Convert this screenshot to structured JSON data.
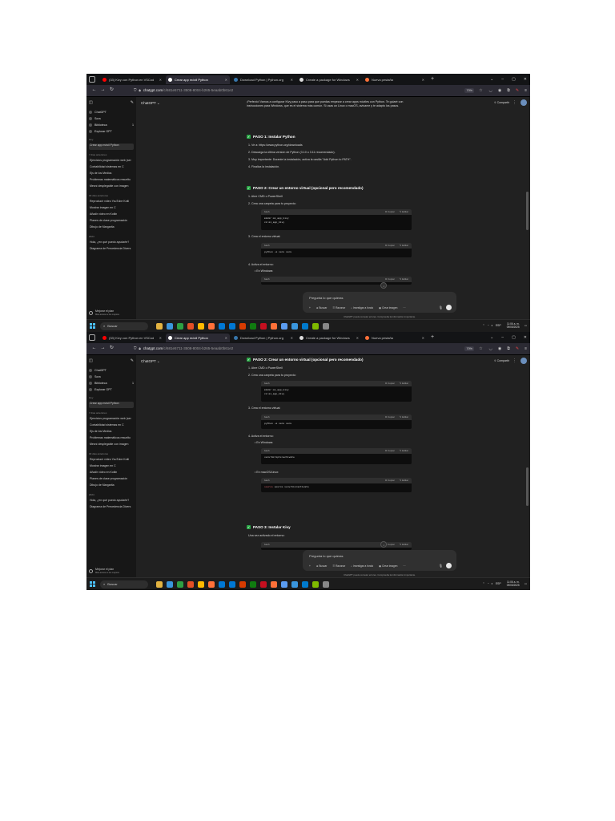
{
  "browser": {
    "tabs": [
      {
        "label": "(33) Kivy con Python en VSCod",
        "color": "#ff0000"
      },
      {
        "label": "Crear app móvil Python",
        "color": "#ffffff",
        "active": true
      },
      {
        "label": "Download Python | Python.org",
        "color": "#3776ab"
      },
      {
        "label": "Create a package for Windows",
        "color": "#dddddd"
      },
      {
        "label": "Nueva pestaña",
        "color": "#ff7139"
      }
    ],
    "new_tab": "+",
    "url_domain": "chatgpt.com",
    "url_path": "/c/681e5711-3508-8004-b265-5eaab0b61e2",
    "zoom": "70%",
    "controls": [
      "⌄",
      "–",
      "▢",
      "✕"
    ]
  },
  "sidebar": {
    "top_items": [
      {
        "label": "ChatGPT"
      },
      {
        "label": "Sora"
      },
      {
        "label": "Biblioteca",
        "count": "1"
      },
      {
        "label": "Explorar GPT"
      }
    ],
    "sections": [
      {
        "title": "Hoy",
        "items": [
          "Crear app móvil Python"
        ]
      },
      {
        "title": "7 días anteriores",
        "items": [
          "Ejercicios programación web (ser",
          "Contabilidad sistemas en C",
          "Ejs de los Medios",
          "Problemas matemáticos resuelto",
          "Mesní desplegable con imagen"
        ]
      },
      {
        "title": "30 días anteriores",
        "items": [
          "Reproducir vídeo YouTube Kotli",
          "Mostrar imagen en C",
          "Añadir vídeo en Kotlin",
          "Planes de clase programación",
          "Dibujo de Margarita"
        ]
      },
      {
        "title": "2024",
        "items": [
          "Hola, ¿en qué puedo ayudarte?",
          "Diagrama de Precedencia Divers"
        ]
      }
    ],
    "plan": "Mejorar el plan",
    "plan_sub": "Más acceso a los mejores"
  },
  "header": {
    "model": "ChatGPT ⌄",
    "share": "⇪ Compartir",
    "more": "⋮"
  },
  "chatA": {
    "intro": "¡Perfecto! Vamos a configurar Kivy paso a paso para que puedas empezar a crear apps móviles con Python. Te guiaré con instrucciones para Windows, que es el sistema más común. Si usas un Linux o macOS, avísame y te adapto los pasos.",
    "step1_title": "PASO 1: Instalar Python",
    "step1_items": [
      "1. Ve a: https://www.python.org/downloads",
      "2. Descarga la última versión de Python (3.10 o 3.11 recomendado).",
      "3. Muy importante: Durante la instalación, activa la casilla \"Add Python to PATH\".",
      "4. Finaliza la instalación."
    ],
    "step2_title": "PASO 2: Crear un entorno virtual (opcional pero recomendado)",
    "step2_i1": "1. Abre CMD o PowerShell",
    "step2_i2": "2. Crea una carpeta para tu proyecto:",
    "code1": "mkdir mi_app_kivy\ncd mi_app_kivy",
    "step2_i3": "3. Crea el entorno virtual:",
    "code2": "python -m venv venv",
    "step2_i4": "4. Activa el entorno:",
    "bullet_win": "• En Windows:"
  },
  "chatB": {
    "step2_title": "PASO 2: Crear un entorno virtual (opcional pero recomendado)",
    "i1": "1. Abre CMD o PowerShell",
    "i2": "2. Crea una carpeta para tu proyecto:",
    "code1": "mkdir mi_app_kivy\ncd mi_app_kivy",
    "i3": "3. Crea el entorno virtual:",
    "code2": "python -m venv venv",
    "i4": "4. Activa el entorno:",
    "bullet_win": "• En Windows:",
    "code3": "venv\\Scripts\\activate",
    "bullet_mac": "• En macOS/Linux:",
    "code4": "source venv/bin/activate",
    "step3_title": "PASO 3: Instalar Kivy",
    "step3_text": "Una vez activado el entorno:"
  },
  "code_bar": {
    "lang": "bash",
    "copy": "⧉ Copiar",
    "edit": "✎ Editar"
  },
  "composer": {
    "placeholder": "Pregunta lo que quieras",
    "tools": [
      "+",
      "⊕ Buscar",
      "☰ Razonar",
      "⌕ Investigar a fondo",
      "▣ Crear imagen",
      "···"
    ],
    "mic": "🎙",
    "disclaimer": "ChatGPT puede cometer errores. Comprueba la información importante."
  },
  "taskbar": {
    "search": "Buscar",
    "apps": [
      "#e3b341",
      "#3a96dd",
      "#2ea043",
      "#e34f26",
      "#ffb900",
      "#ff7139",
      "#0078d4",
      "#0078d4",
      "#d83b01",
      "#107c10",
      "#c50f1f",
      "#ff7139",
      "#5b9cf0",
      "#3a96dd",
      "#007acc",
      "#7fba00",
      "#888888"
    ],
    "lang": "ESP",
    "time": "11:06 a. m.",
    "date": "09/05/2025"
  }
}
